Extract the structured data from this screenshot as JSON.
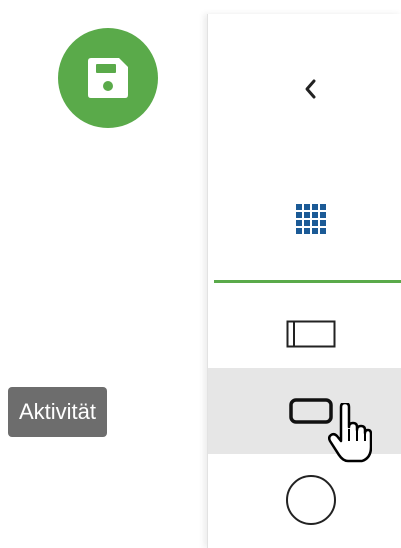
{
  "toolbar": {
    "save_button": {
      "icon": "floppy-disk-icon",
      "color": "#5aaa4a"
    }
  },
  "tooltip": {
    "text": "Aktivität"
  },
  "palette": {
    "collapse": {
      "icon": "chevron-left-icon"
    },
    "all_shapes": {
      "icon": "grid-icon",
      "color": "#1b5a96"
    },
    "divider_color": "#5aaa4a",
    "tools": [
      {
        "name": "pool",
        "icon": "pool-rectangle-icon"
      },
      {
        "name": "task",
        "icon": "rounded-rectangle-icon",
        "hovered": true
      },
      {
        "name": "event",
        "icon": "circle-icon"
      }
    ]
  },
  "cursor": {
    "icon": "hand-pointer-icon"
  }
}
